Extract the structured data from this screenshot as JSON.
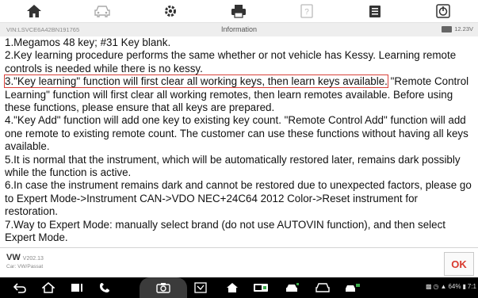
{
  "toolbar": {
    "buttons": [
      {
        "name": "home",
        "icon": "home-icon"
      },
      {
        "name": "vehicle",
        "icon": "car-icon"
      },
      {
        "name": "settings",
        "icon": "gear-icon"
      },
      {
        "name": "print",
        "icon": "printer-icon"
      },
      {
        "name": "help",
        "icon": "help-icon"
      },
      {
        "name": "datalog",
        "icon": "clipboard-icon"
      },
      {
        "name": "exit",
        "icon": "exit-icon"
      }
    ]
  },
  "status": {
    "vin": "VIN:LSVCE6A42BN191765",
    "title": "Information",
    "voltage": "12.23V"
  },
  "info": {
    "line1": "1.Megamos 48 key; #31 Key blank.",
    "line2": "2.Key learning procedure performs the same whether or not vehicle has Kessy. Learning remote controls is needed while there is no kessy.",
    "line3_highlight": "3.\"Key learning\" function will first clear all working keys, then learn keys available.",
    "line3_rest": " \"Remote Control Learning\" function will first clear all working remotes, then learn remotes available. Before using these functions, please ensure that all keys are prepared.",
    "line4": "4.\"Key Add\" function will add one key to existing key count. \"Remote Control Add\" function will add one remote to existing remote count. The customer can use these functions without having all keys available.",
    "line5": "5.It is normal that the instrument, which will be automatically restored later, remains dark possibly while the function is active.",
    "line6": "6.In case the instrument remains dark and cannot be restored due to unexpected factors, please go to Expert Mode->Instrument CAN->VDO NEC+24C64 2012 Color->Reset instrument for restoration.",
    "line7": "7.Way to Expert Mode: manually select brand (do not use AUTOVIN function), and then select Expert Mode."
  },
  "footer": {
    "make": "VW",
    "version": "V202.13",
    "path": "Car: VW/Passat",
    "ok_label": "OK"
  },
  "navbar": {
    "battery_percent": "64%",
    "time": "7:1"
  },
  "colors": {
    "highlight": "#d9413a",
    "ok_text": "#d83a2f"
  }
}
